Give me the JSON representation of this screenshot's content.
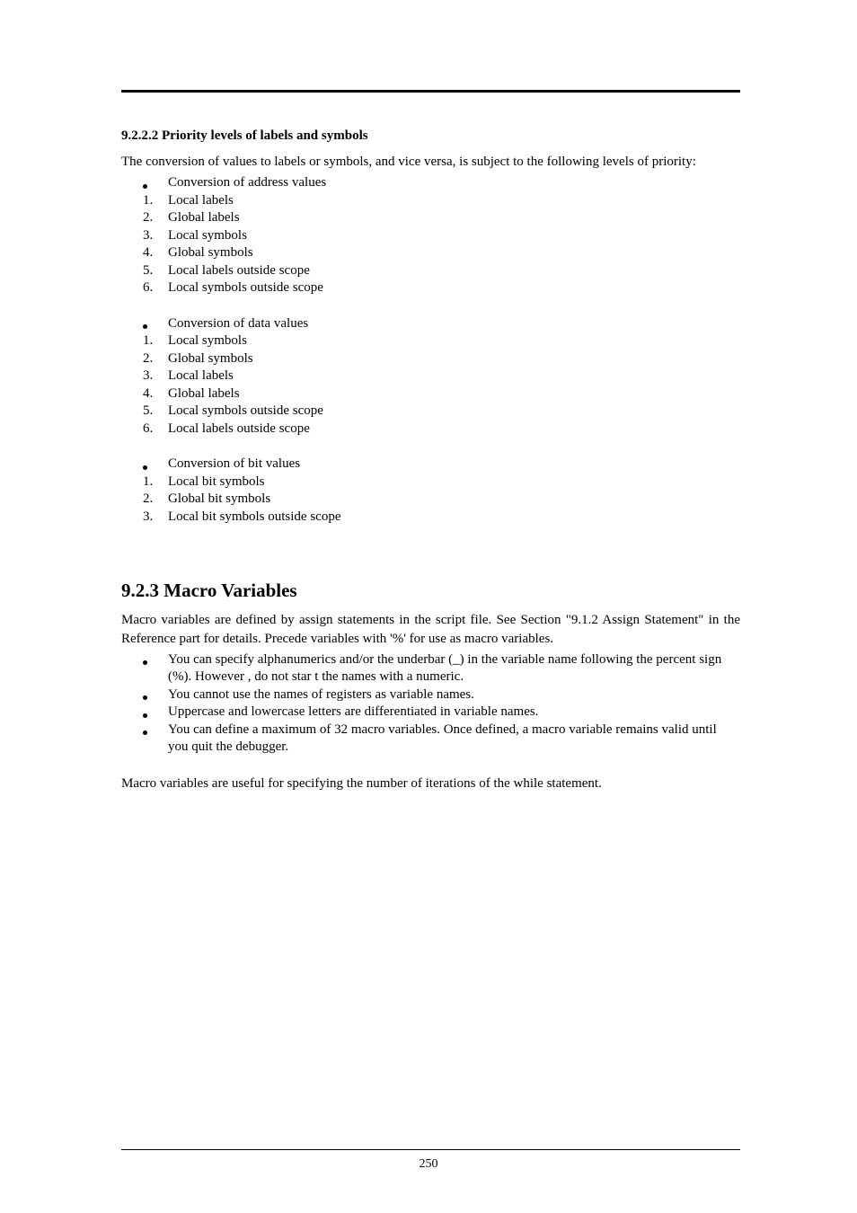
{
  "page_number": "250",
  "sec1": {
    "heading": "9.2.2.2 Priority levels of labels and symbols",
    "intro": "The conversion of values to labels or symbols, and vice versa, is subject to the following levels of priority:",
    "groupA": {
      "title": "Conversion of address values",
      "items": [
        "Local labels",
        "Global labels",
        "Local symbols",
        "Global symbols",
        "Local labels outside scope",
        "Local symbols outside scope"
      ]
    },
    "groupB": {
      "title": "Conversion of data values",
      "items": [
        "Local symbols",
        "Global symbols",
        "Local labels",
        "Global labels",
        "Local symbols outside scope",
        "Local labels outside scope"
      ]
    },
    "groupC": {
      "title": "Conversion of bit values",
      "items": [
        "Local bit symbols",
        "Global bit symbols",
        "Local bit symbols outside scope"
      ]
    }
  },
  "sec2": {
    "heading": "9.2.3 Macro Variables",
    "p1": "Macro variables are defined by assign statements in the script file. See Section  \"9.1.2 Assign Statement\" in the Reference part for details. Precede variables with '%' for use as macro variables.",
    "bullets": [
      "You can specify alphanumerics and/or the underbar (_) in the variable name following the percent sign (%). However , do not star t the names with a numeric.",
      "You cannot use the names of registers as variable names.",
      "Uppercase and lowercase letters are differentiated in variable names.",
      "You can define a maximum of 32 macro variables. Once defined, a macro variable remains valid until you quit the debugger."
    ],
    "p2": "Macro variables are useful for specifying the number of iterations of the while statement."
  }
}
